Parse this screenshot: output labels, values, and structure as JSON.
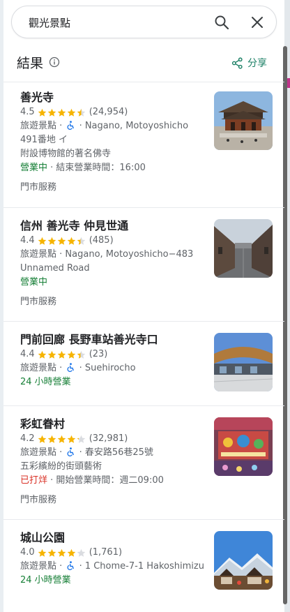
{
  "search": {
    "value": "觀光景點"
  },
  "header": {
    "title": "結果",
    "share_label": "分享"
  },
  "results": [
    {
      "name": "善光寺",
      "rating": "4.5",
      "stars": 4.5,
      "reviews": "(24,954)",
      "category": "旅遊景點",
      "address": "· Nagano, Motoyoshicho",
      "address2": "491番地 イ",
      "description": "附設博物館的著名佛寺",
      "status": "營業中",
      "status_extra": " · 結束營業時間：16:00",
      "service": "門市服務"
    },
    {
      "name": "信州 善光寺 仲見世通",
      "rating": "4.4",
      "stars": 4.4,
      "reviews": "(485)",
      "category": "旅遊景點",
      "address": "· Nagano, Motoyoshicho−483",
      "address2": "Unnamed Road",
      "status": "營業中",
      "service": "門市服務"
    },
    {
      "name": "門前回廊 長野車站善光寺口",
      "rating": "4.4",
      "stars": 4.4,
      "reviews": "(23)",
      "category": "旅遊景點",
      "address": "· Suehirocho",
      "status": "24 小時營業"
    },
    {
      "name": "彩虹眷村",
      "rating": "4.2",
      "stars": 4.2,
      "reviews": "(32,981)",
      "category": "旅遊景點",
      "address": "· 春安路56巷25號",
      "description": "五彩繽紛的街頭藝術",
      "status": "已打烊",
      "status_extra": " · 開始營業時間：週二09:00",
      "service": "門市服務"
    },
    {
      "name": "城山公園",
      "rating": "4.0",
      "stars": 4.0,
      "reviews": "(1,761)",
      "category": "旅遊景點",
      "address": "· 1 Chome-7-1 Hakoshimizu",
      "status": "24 小時營業"
    }
  ],
  "colors": {
    "accent": "#1a7f64",
    "open": "#188038",
    "closed": "#d93025",
    "star": "#f6b400"
  }
}
